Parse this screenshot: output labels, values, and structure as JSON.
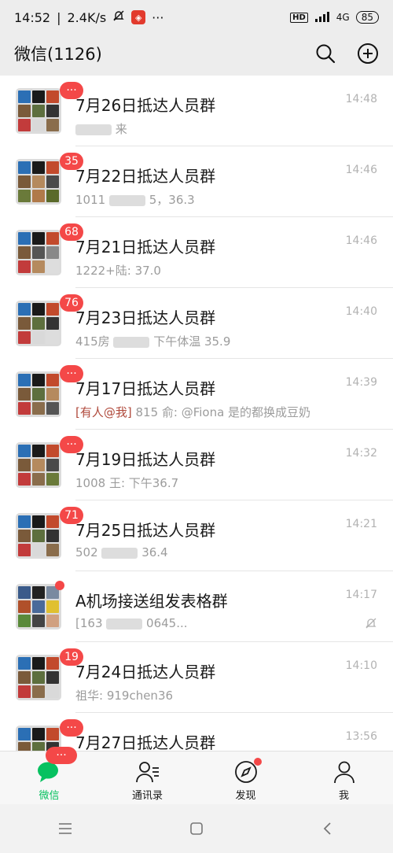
{
  "status_bar": {
    "time": "14:52",
    "speed": "2.4K/s",
    "network": "4G",
    "battery": "85",
    "hd": "HD",
    "more": "···"
  },
  "header": {
    "title": "微信(1126)"
  },
  "chats": [
    {
      "name": "7月26日抵达人员群",
      "time": "14:48",
      "badge": "···",
      "preview": "",
      "preview_tail": "来",
      "palette": [
        "#2b6fb5",
        "#1a1a1a",
        "#c24a2c",
        "#7a5a3a",
        "#5d6f3e",
        "#333",
        "#c23b3b",
        "#d9d9d9",
        "#8a6d4c"
      ]
    },
    {
      "name": "7月22日抵达人员群",
      "time": "14:46",
      "badge": "35",
      "preview": "1011",
      "preview_tail": "5，36.3",
      "palette": [
        "#2b6fb5",
        "#1a1a1a",
        "#c24a2c",
        "#7a5a3a",
        "#b58a5e",
        "#4a4a4a",
        "#6a7a3a",
        "#b07a4a",
        "#5a6a2a"
      ]
    },
    {
      "name": "7月21日抵达人员群",
      "time": "14:46",
      "badge": "68",
      "preview": "1222+陆: 37.0",
      "preview_tail": "",
      "palette": [
        "#2b6fb5",
        "#1a1a1a",
        "#c24a2c",
        "#7a5a3a",
        "#555",
        "#888",
        "#c23b3b",
        "#b58a5e",
        "#ddd"
      ]
    },
    {
      "name": "7月23日抵达人员群",
      "time": "14:40",
      "badge": "76",
      "preview": "415房",
      "preview_tail": "下午体温 35.9",
      "palette": [
        "#2b6fb5",
        "#1a1a1a",
        "#c24a2c",
        "#7a5a3a",
        "#5d6f3e",
        "#333",
        "#c23b3b",
        "#d9d9d9",
        "#ddd"
      ]
    },
    {
      "name": "7月17日抵达人员群",
      "time": "14:39",
      "badge": "···",
      "mention": "[有人@我]",
      "preview": " 815  俞: @Fiona 是的都换成豆奶",
      "preview_tail": "",
      "palette": [
        "#2b6fb5",
        "#1a1a1a",
        "#c24a2c",
        "#7a5a3a",
        "#5d6f3e",
        "#b58a5e",
        "#c23b3b",
        "#8a6d4c",
        "#555"
      ]
    },
    {
      "name": "7月19日抵达人员群",
      "time": "14:32",
      "badge": "···",
      "preview": "1008 王: 下午36.7",
      "preview_tail": "",
      "palette": [
        "#2b6fb5",
        "#1a1a1a",
        "#c24a2c",
        "#7a5a3a",
        "#b58a5e",
        "#4a4a4a",
        "#c23b3b",
        "#8a6d4c",
        "#6a7a3a"
      ]
    },
    {
      "name": "7月25日抵达人员群",
      "time": "14:21",
      "badge": "71",
      "preview": "502",
      "preview_tail": "36.4",
      "palette": [
        "#2b6fb5",
        "#1a1a1a",
        "#c24a2c",
        "#7a5a3a",
        "#5d6f3e",
        "#333",
        "#c23b3b",
        "#d9d9d9",
        "#8a6d4c"
      ]
    },
    {
      "name": "A机场接送组发表格群",
      "time": "14:17",
      "badge": "",
      "dot": true,
      "muted": true,
      "preview": "[163",
      "preview_tail": "0645...",
      "palette": [
        "#3a5a8a",
        "#222",
        "#7a8aa0",
        "#b0502a",
        "#4a6a9a",
        "#e0c030",
        "#5a8a3a",
        "#444",
        "#d0a080"
      ]
    },
    {
      "name": "7月24日抵达人员群",
      "time": "14:10",
      "badge": "19",
      "preview": "祖华: 919chen36",
      "preview_tail": "",
      "palette": [
        "#2b6fb5",
        "#1a1a1a",
        "#c24a2c",
        "#7a5a3a",
        "#5d6f3e",
        "#333",
        "#c23b3b",
        "#8a6d4c",
        "#d9d9d9"
      ]
    },
    {
      "name": "7月27日抵达人员群",
      "time": "13:56",
      "badge": "···",
      "preview": "",
      "preview_tail": "",
      "palette": [
        "#2b6fb5",
        "#1a1a1a",
        "#c24a2c",
        "#7a5a3a",
        "#5d6f3e",
        "#333",
        "#c23b3b",
        "#d9d9d9",
        "#8a6d4c"
      ]
    }
  ],
  "tabs": [
    {
      "label": "微信",
      "badge": "···",
      "icon": "chat-icon",
      "active": true
    },
    {
      "label": "通讯录",
      "icon": "contacts-icon"
    },
    {
      "label": "发现",
      "icon": "compass-icon",
      "dot": true
    },
    {
      "label": "我",
      "icon": "person-icon"
    }
  ],
  "colors": {
    "accent": "#07c160",
    "badge": "#f44848",
    "mention": "#b04a3c"
  }
}
